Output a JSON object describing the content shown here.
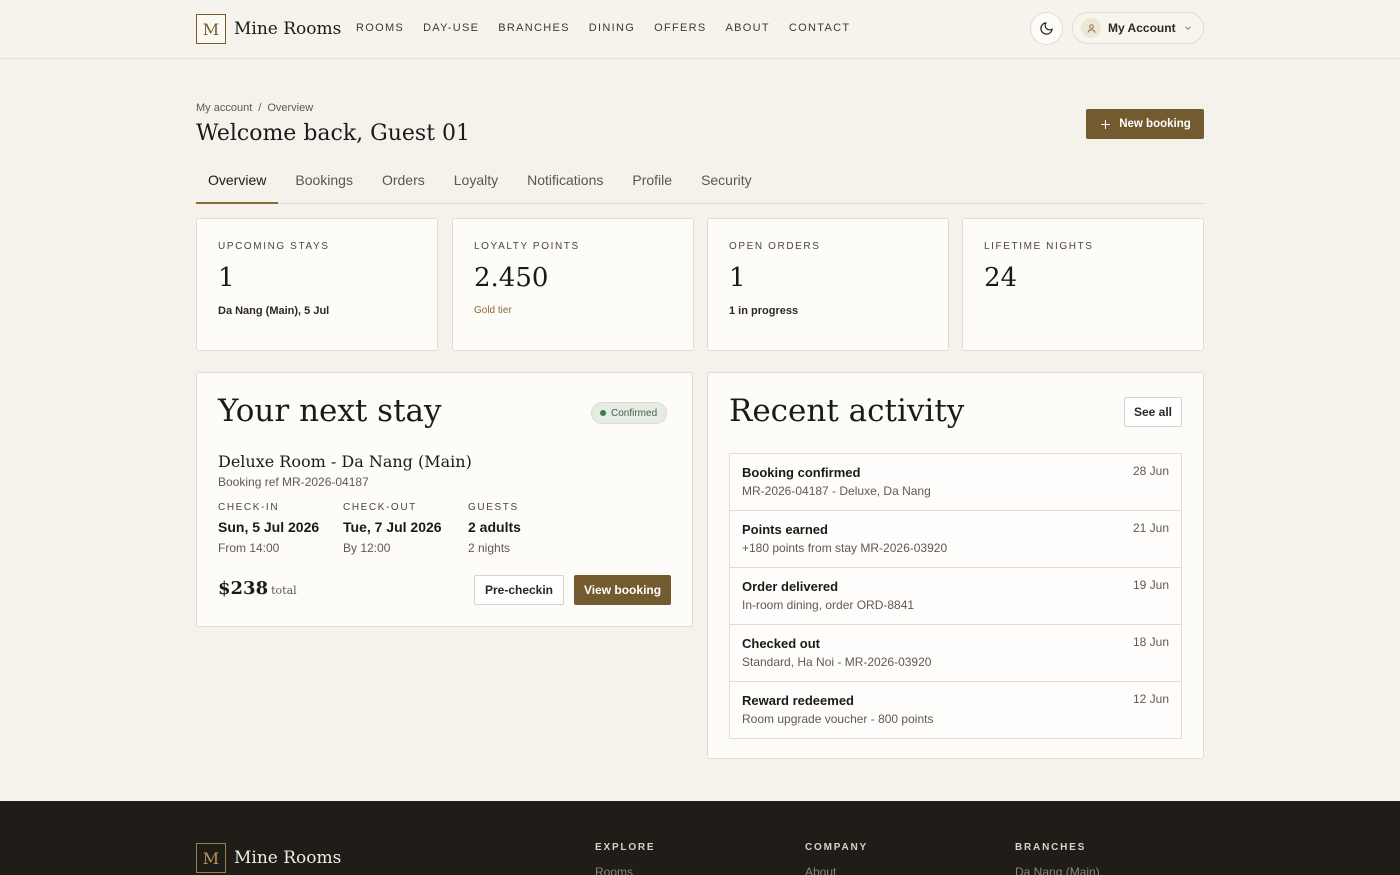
{
  "brand": {
    "mark": "M",
    "name": "Mine Rooms"
  },
  "nav": [
    "ROOMS",
    "DAY-USE",
    "BRANCHES",
    "DINING",
    "OFFERS",
    "ABOUT",
    "CONTACT"
  ],
  "header": {
    "account_label": "My Account"
  },
  "breadcrumb": {
    "root": "My account",
    "separator": "/",
    "current": "Overview"
  },
  "page": {
    "title": "Welcome back, Guest 01",
    "new_booking_label": "New booking"
  },
  "tabs": [
    "Overview",
    "Bookings",
    "Orders",
    "Loyalty",
    "Notifications",
    "Profile",
    "Security"
  ],
  "stats": [
    {
      "label": "UPCOMING STAYS",
      "value": "1",
      "sub": "Da Nang (Main), 5 Jul"
    },
    {
      "label": "LOYALTY POINTS",
      "value": "2.450",
      "sub": "Gold tier"
    },
    {
      "label": "OPEN ORDERS",
      "value": "1",
      "sub": "1 in progress"
    },
    {
      "label": "LIFETIME NIGHTS",
      "value": "24",
      "sub": ""
    }
  ],
  "next_stay": {
    "title": "Your next stay",
    "status": "Confirmed",
    "room": "Deluxe Room - Da Nang (Main)",
    "ref": "Booking ref MR-2026-04187",
    "checkin": {
      "label": "CHECK-IN",
      "value": "Sun, 5 Jul 2026",
      "sub": "From 14:00"
    },
    "checkout": {
      "label": "CHECK-OUT",
      "value": "Tue, 7 Jul 2026",
      "sub": "By 12:00"
    },
    "guests": {
      "label": "GUESTS",
      "value": "2 adults",
      "sub": "2 nights"
    },
    "price": "$238",
    "price_label": "total",
    "precheckin_label": "Pre-checkin",
    "view_label": "View booking"
  },
  "activity": {
    "title": "Recent activity",
    "see_all_label": "See all",
    "items": [
      {
        "title": "Booking confirmed",
        "desc": "MR-2026-04187 - Deluxe, Da Nang",
        "date": "28 Jun"
      },
      {
        "title": "Points earned",
        "desc": "+180 points from stay MR-2026-03920",
        "date": "21 Jun"
      },
      {
        "title": "Order delivered",
        "desc": "In-room dining, order ORD-8841",
        "date": "19 Jun"
      },
      {
        "title": "Checked out",
        "desc": "Standard, Ha Noi - MR-2026-03920",
        "date": "18 Jun"
      },
      {
        "title": "Reward redeemed",
        "desc": "Room upgrade voucher - 800 points",
        "date": "12 Jun"
      }
    ]
  },
  "footer": {
    "brand_name": "Mine Rooms",
    "columns": [
      {
        "heading": "EXPLORE",
        "first_link": "Rooms"
      },
      {
        "heading": "COMPANY",
        "first_link": "About"
      },
      {
        "heading": "BRANCHES",
        "first_link": "Da Nang (Main)"
      }
    ]
  },
  "colors": {
    "accent": "#745a2f",
    "background": "#f5f2ec",
    "card": "#fdfcf9",
    "footer": "#201c18",
    "confirmed": "#3f7a4d"
  }
}
